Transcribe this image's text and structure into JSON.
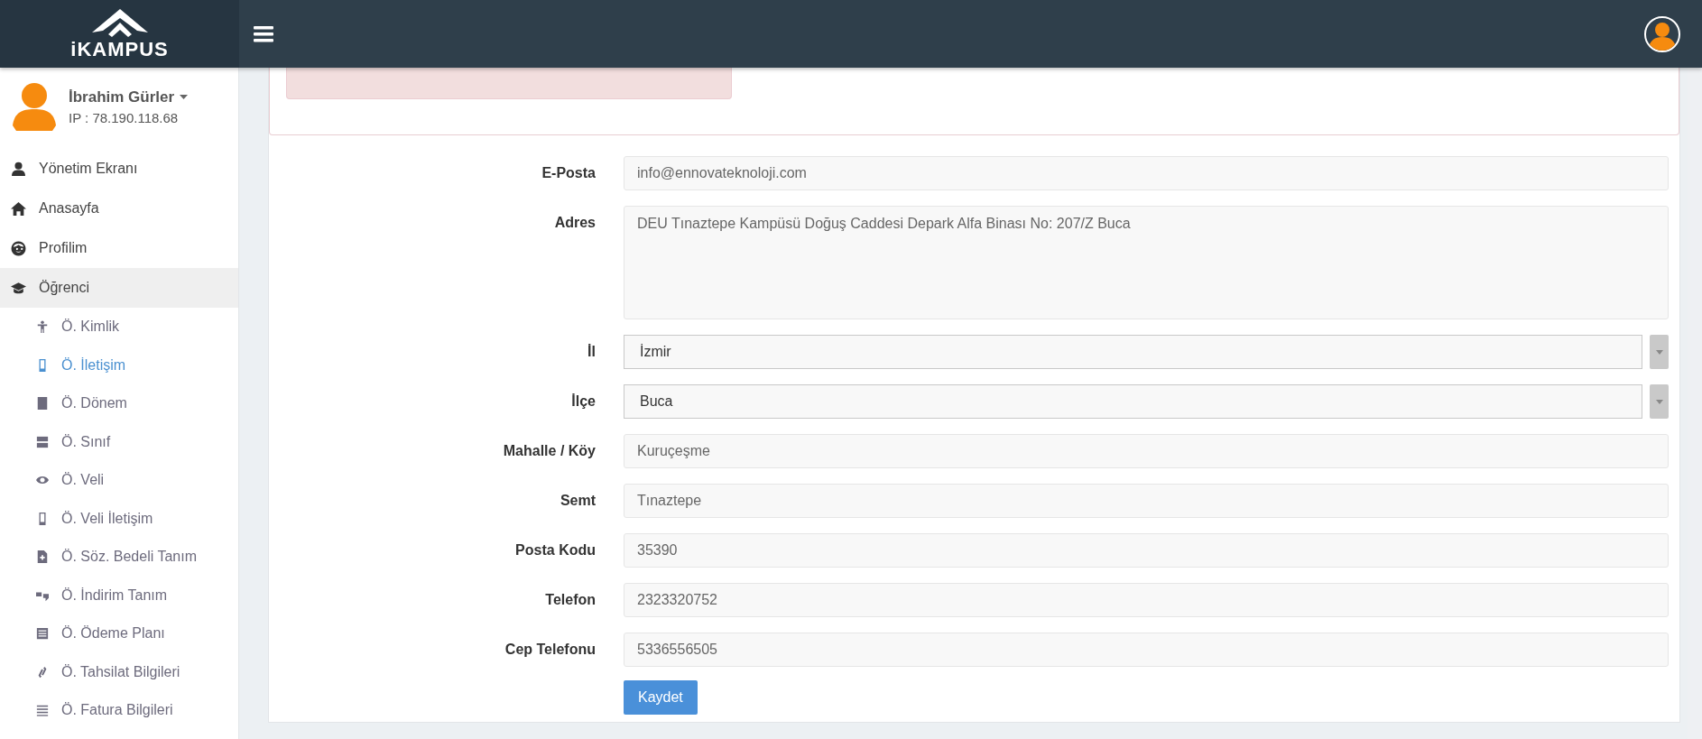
{
  "brand": {
    "name": "iKAMPUS"
  },
  "user": {
    "name": "İbrahim Gürler",
    "ip": "IP : 78.190.118.68"
  },
  "menu": [
    {
      "label": "Yönetim Ekranı",
      "expanded": false
    },
    {
      "label": "Anasayfa",
      "expanded": false
    },
    {
      "label": "Profilim",
      "expanded": false
    },
    {
      "label": "Öğrenci",
      "expanded": true,
      "children": [
        {
          "label": "Ö. Kimlik",
          "selected": false
        },
        {
          "label": "Ö. İletişim",
          "selected": true
        },
        {
          "label": "Ö. Dönem",
          "selected": false
        },
        {
          "label": "Ö. Sınıf",
          "selected": false
        },
        {
          "label": "Ö. Veli",
          "selected": false
        },
        {
          "label": "Ö. Veli İletişim",
          "selected": false
        },
        {
          "label": "Ö. Söz. Bedeli Tanım",
          "selected": false
        },
        {
          "label": "Ö. İndirim Tanım",
          "selected": false
        },
        {
          "label": "Ö. Ödeme Planı",
          "selected": false
        },
        {
          "label": "Ö. Tahsilat Bilgileri",
          "selected": false
        },
        {
          "label": "Ö. Fatura Bilgileri",
          "selected": false
        }
      ]
    }
  ],
  "form": {
    "fields": [
      {
        "kind": "input",
        "label": "E-Posta",
        "value": "info@ennovateknoloji.com"
      },
      {
        "kind": "textarea",
        "label": "Adres",
        "value": "DEU Tınaztepe Kampüsü Doğuş Caddesi Depark Alfa Binası No: 207/Z Buca"
      },
      {
        "kind": "select",
        "label": "İl",
        "value": "İzmir"
      },
      {
        "kind": "select",
        "label": "İlçe",
        "value": "Buca"
      },
      {
        "kind": "input",
        "label": "Mahalle / Köy",
        "value": "Kuruçeşme"
      },
      {
        "kind": "input",
        "label": "Semt",
        "value": "Tınaztepe"
      },
      {
        "kind": "input",
        "label": "Posta Kodu",
        "value": "35390"
      },
      {
        "kind": "input",
        "label": "Telefon",
        "value": "2323320752"
      },
      {
        "kind": "input",
        "label": "Cep Telefonu",
        "value": "5336556505"
      }
    ],
    "submit": "Kaydet"
  }
}
